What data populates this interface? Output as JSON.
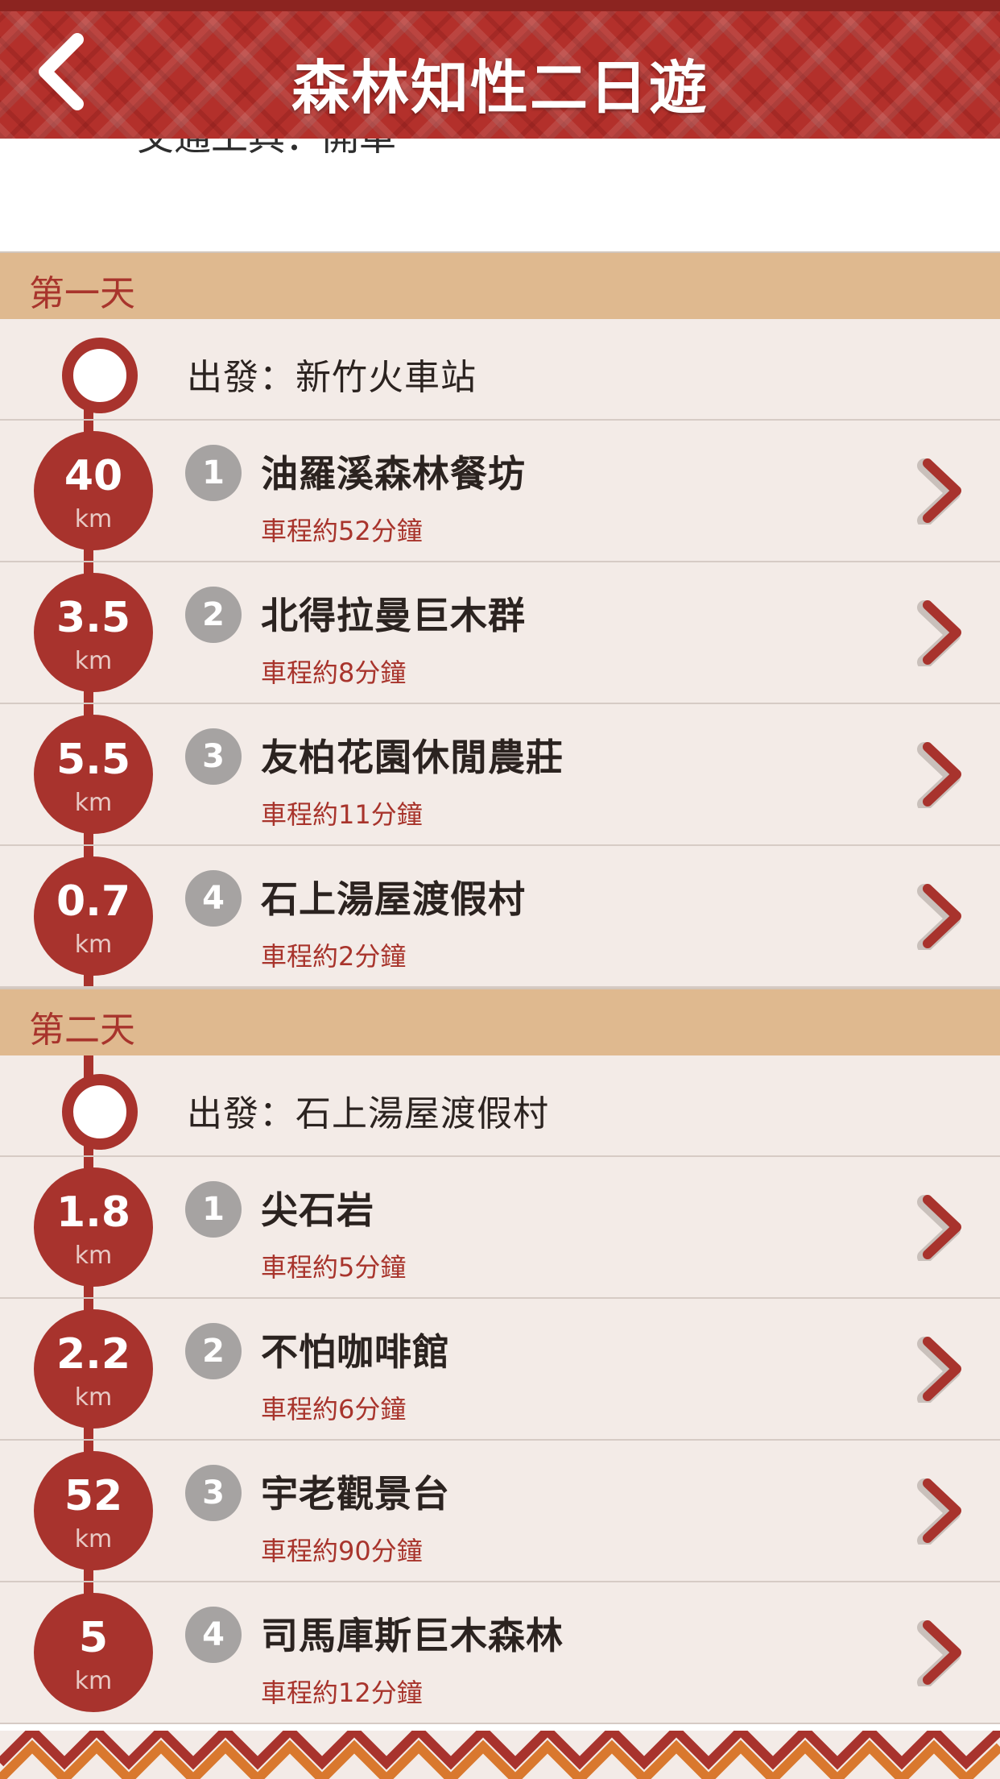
{
  "header": {
    "title": "森林知性二日遊",
    "back_icon": "chevron-left-icon"
  },
  "intro": {
    "text": "交通工具：開車"
  },
  "colors": {
    "brand": "#b3302b",
    "day_header": "#dfb98f",
    "row_bg": "#f3ebe7",
    "accent": "#a8332d",
    "badge": "#a6a3a2"
  },
  "days": [
    {
      "label": "第一天",
      "departure": "出發：新竹火車站",
      "stops": [
        {
          "number": "1",
          "distance": "40",
          "unit": "km",
          "name": "油羅溪森林餐坊",
          "time": "車程約52分鐘"
        },
        {
          "number": "2",
          "distance": "3.5",
          "unit": "km",
          "name": "北得拉曼巨木群",
          "time": "車程約8分鐘"
        },
        {
          "number": "3",
          "distance": "5.5",
          "unit": "km",
          "name": "友柏花園休閒農莊",
          "time": "車程約11分鐘"
        },
        {
          "number": "4",
          "distance": "0.7",
          "unit": "km",
          "name": "石上湯屋渡假村",
          "time": "車程約2分鐘"
        }
      ]
    },
    {
      "label": "第二天",
      "departure": "出發：石上湯屋渡假村",
      "stops": [
        {
          "number": "1",
          "distance": "1.8",
          "unit": "km",
          "name": "尖石岩",
          "time": "車程約5分鐘"
        },
        {
          "number": "2",
          "distance": "2.2",
          "unit": "km",
          "name": "不怕咖啡館",
          "time": "車程約6分鐘"
        },
        {
          "number": "3",
          "distance": "52",
          "unit": "km",
          "name": "宇老觀景台",
          "time": "車程約90分鐘"
        },
        {
          "number": "4",
          "distance": "5",
          "unit": "km",
          "name": "司馬庫斯巨木森林",
          "time": "車程約12分鐘"
        }
      ]
    }
  ]
}
